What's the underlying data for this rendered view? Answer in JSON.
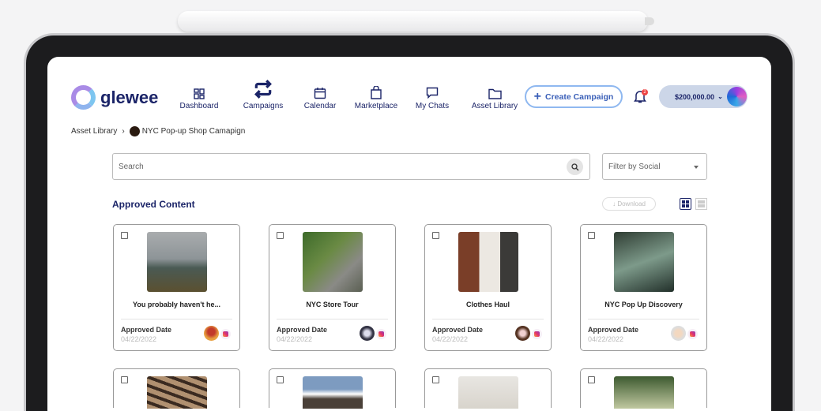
{
  "brand": {
    "name": "glewee"
  },
  "nav": [
    {
      "label": "Dashboard",
      "icon": "dashboard-icon"
    },
    {
      "label": "Campaigns",
      "icon": "repeat-icon"
    },
    {
      "label": "Calendar",
      "icon": "calendar-icon"
    },
    {
      "label": "Marketplace",
      "icon": "shopping-bag-icon"
    },
    {
      "label": "My Chats",
      "icon": "chat-icon"
    },
    {
      "label": "Asset Library",
      "icon": "folder-icon"
    }
  ],
  "header": {
    "create_label": "Create Campaign",
    "notification_count": "2",
    "balance": "$200,000.00"
  },
  "breadcrumb": {
    "root": "Asset Library",
    "current": "NYC Pop-up Shop Camapign"
  },
  "search": {
    "placeholder": "Search"
  },
  "filter": {
    "placeholder": "Filter by Social"
  },
  "section": {
    "title": "Approved Content",
    "download_label": "Download"
  },
  "cards": [
    {
      "title": "You probably haven't he...",
      "date_label": "Approved Date",
      "date": "04/22/2022"
    },
    {
      "title": "NYC Store Tour",
      "date_label": "Approved Date",
      "date": "04/22/2022"
    },
    {
      "title": "Clothes Haul",
      "date_label": "Approved Date",
      "date": "04/22/2022"
    },
    {
      "title": "NYC Pop Up Discovery",
      "date_label": "Approved Date",
      "date": "04/22/2022"
    }
  ]
}
